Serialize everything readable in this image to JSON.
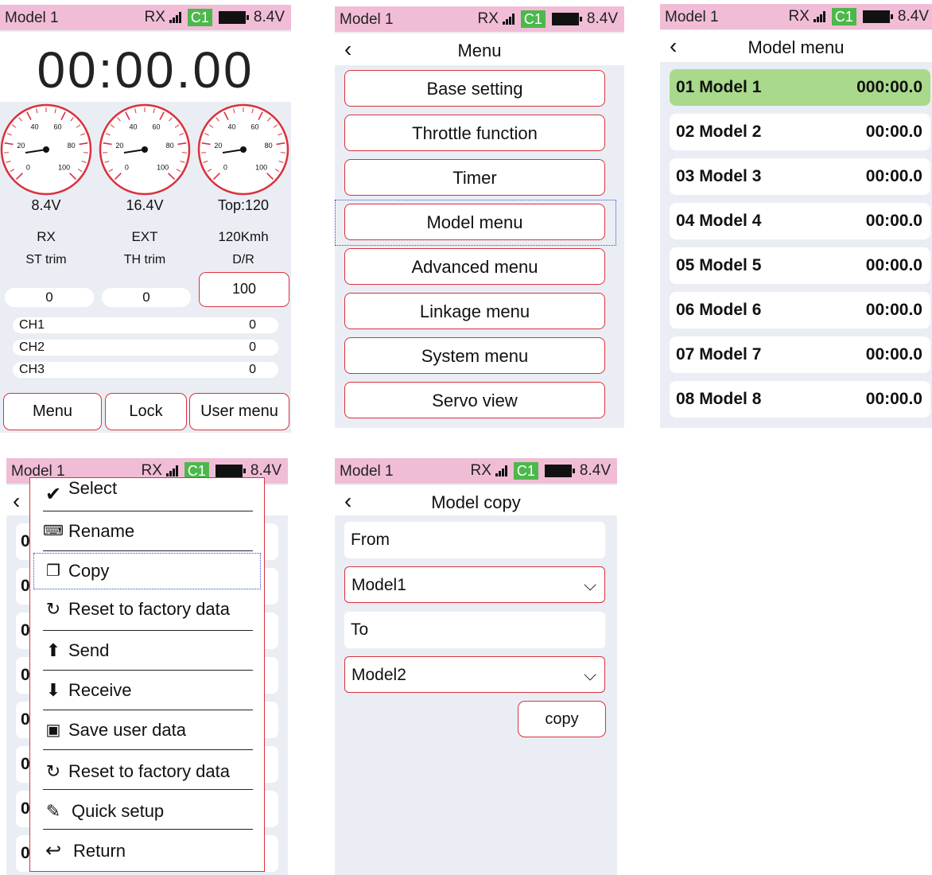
{
  "status": {
    "model": "Model 1",
    "rx": "RX",
    "channel": "C1",
    "voltage": "8.4V"
  },
  "home": {
    "timer": "00:00.00",
    "gauge_ticks": [
      "0",
      "20",
      "40",
      "60",
      "80",
      "100"
    ],
    "gauges": [
      {
        "value": "8.4V",
        "label": "RX",
        "trim_label": "ST trim",
        "trim_value": "0"
      },
      {
        "value": "16.4V",
        "label": "EXT",
        "trim_label": "TH trim",
        "trim_value": "0"
      },
      {
        "value": "Top:120",
        "label": "120Kmh",
        "trim_label": "D/R",
        "trim_value": "100"
      }
    ],
    "channels": [
      {
        "name": "CH1",
        "value": "0"
      },
      {
        "name": "CH2",
        "value": "0"
      },
      {
        "name": "CH3",
        "value": "0"
      }
    ],
    "buttons": {
      "menu": "Menu",
      "lock": "Lock",
      "user_menu": "User menu"
    }
  },
  "menu": {
    "title": "Menu",
    "items": [
      "Base setting",
      "Throttle function",
      "Timer",
      "Model menu",
      "Advanced menu",
      "Linkage menu",
      "System menu",
      "Servo view"
    ]
  },
  "model_menu": {
    "title": "Model menu",
    "models": [
      {
        "name": "01 Model 1",
        "time": "000:00.0"
      },
      {
        "name": "02 Model 2",
        "time": "00:00.0"
      },
      {
        "name": "03 Model 3",
        "time": "00:00.0"
      },
      {
        "name": "04 Model 4",
        "time": "00:00.0"
      },
      {
        "name": "05 Model 5",
        "time": "00:00.0"
      },
      {
        "name": "06 Model 6",
        "time": "00:00.0"
      },
      {
        "name": "07 Model 7",
        "time": "00:00.0"
      },
      {
        "name": "08 Model 8",
        "time": "00:00.0"
      }
    ]
  },
  "popup": {
    "row_prefix": "0",
    "items": [
      {
        "icon": "check-icon",
        "label": "Select"
      },
      {
        "icon": "keyboard-icon",
        "label": "Rename"
      },
      {
        "icon": "copy-icon",
        "label": "Copy"
      },
      {
        "icon": "refresh-icon",
        "label": "Reset to factory data"
      },
      {
        "icon": "upload-icon",
        "label": "Send"
      },
      {
        "icon": "download-icon",
        "label": "Receive"
      },
      {
        "icon": "save-icon",
        "label": "Save user data"
      },
      {
        "icon": "refresh-icon",
        "label": "Reset to factory data"
      },
      {
        "icon": "pencil-icon",
        "label": "Quick setup"
      },
      {
        "icon": "return-icon",
        "label": "Return"
      }
    ]
  },
  "model_copy": {
    "title": "Model copy",
    "from_label": "From",
    "from_value": "Model1",
    "to_label": "To",
    "to_value": "Model2",
    "copy_button": "copy"
  },
  "colors": {
    "status_bar": "#f1bdd6",
    "accent_red": "#d9323c",
    "channel_chip": "#4cb84c",
    "selected_row": "#a9d98c",
    "screen_bg": "#eaeef4"
  }
}
